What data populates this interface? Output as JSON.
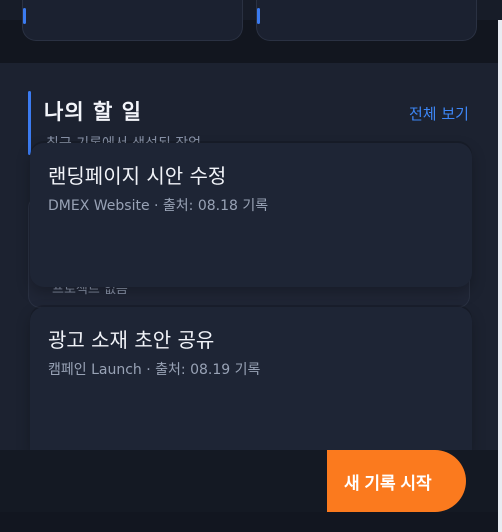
{
  "section": {
    "title": "나의 할 일",
    "view_all_label": "전체 보기",
    "subtitle": "최근 기록에서 생성된 작업",
    "empty_text": "프로젝트 없음"
  },
  "tasks": [
    {
      "title": "랜딩페이지 시안 수정",
      "meta": "DMEX Website · 출처: 08.18 기록"
    },
    {
      "title": "광고 소재 초안 공유",
      "meta": "캠페인 Launch · 출처: 08.19 기록"
    }
  ],
  "cta": {
    "label": "새 기록 시작"
  },
  "colors": {
    "accent": "#3b7bf0",
    "link": "#3d86f5",
    "cta": "#fb7a1e",
    "background": "#1c2230"
  }
}
